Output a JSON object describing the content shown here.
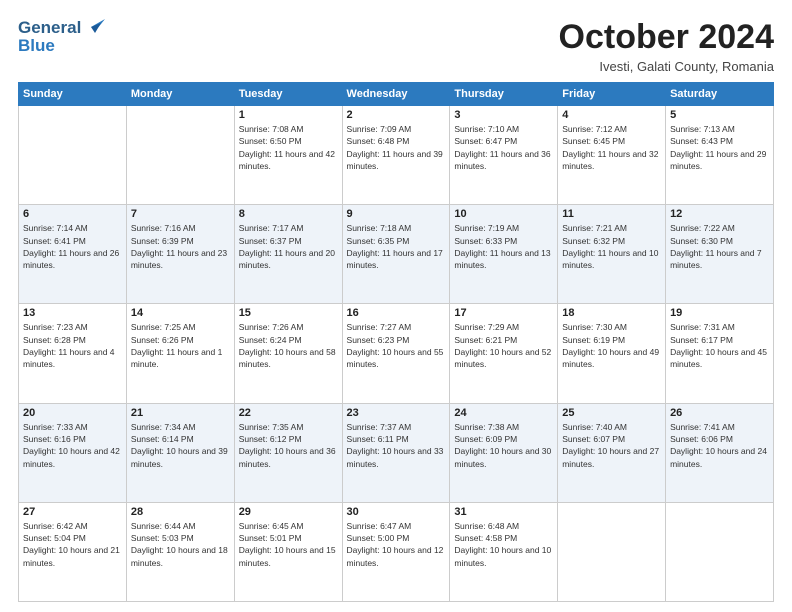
{
  "header": {
    "logo_general": "General",
    "logo_blue": "Blue",
    "title": "October 2024",
    "location": "Ivesti, Galati County, Romania"
  },
  "days_of_week": [
    "Sunday",
    "Monday",
    "Tuesday",
    "Wednesday",
    "Thursday",
    "Friday",
    "Saturday"
  ],
  "weeks": [
    [
      {
        "day": "",
        "sunrise": "",
        "sunset": "",
        "daylight": ""
      },
      {
        "day": "",
        "sunrise": "",
        "sunset": "",
        "daylight": ""
      },
      {
        "day": "1",
        "sunrise": "Sunrise: 7:08 AM",
        "sunset": "Sunset: 6:50 PM",
        "daylight": "Daylight: 11 hours and 42 minutes."
      },
      {
        "day": "2",
        "sunrise": "Sunrise: 7:09 AM",
        "sunset": "Sunset: 6:48 PM",
        "daylight": "Daylight: 11 hours and 39 minutes."
      },
      {
        "day": "3",
        "sunrise": "Sunrise: 7:10 AM",
        "sunset": "Sunset: 6:47 PM",
        "daylight": "Daylight: 11 hours and 36 minutes."
      },
      {
        "day": "4",
        "sunrise": "Sunrise: 7:12 AM",
        "sunset": "Sunset: 6:45 PM",
        "daylight": "Daylight: 11 hours and 32 minutes."
      },
      {
        "day": "5",
        "sunrise": "Sunrise: 7:13 AM",
        "sunset": "Sunset: 6:43 PM",
        "daylight": "Daylight: 11 hours and 29 minutes."
      }
    ],
    [
      {
        "day": "6",
        "sunrise": "Sunrise: 7:14 AM",
        "sunset": "Sunset: 6:41 PM",
        "daylight": "Daylight: 11 hours and 26 minutes."
      },
      {
        "day": "7",
        "sunrise": "Sunrise: 7:16 AM",
        "sunset": "Sunset: 6:39 PM",
        "daylight": "Daylight: 11 hours and 23 minutes."
      },
      {
        "day": "8",
        "sunrise": "Sunrise: 7:17 AM",
        "sunset": "Sunset: 6:37 PM",
        "daylight": "Daylight: 11 hours and 20 minutes."
      },
      {
        "day": "9",
        "sunrise": "Sunrise: 7:18 AM",
        "sunset": "Sunset: 6:35 PM",
        "daylight": "Daylight: 11 hours and 17 minutes."
      },
      {
        "day": "10",
        "sunrise": "Sunrise: 7:19 AM",
        "sunset": "Sunset: 6:33 PM",
        "daylight": "Daylight: 11 hours and 13 minutes."
      },
      {
        "day": "11",
        "sunrise": "Sunrise: 7:21 AM",
        "sunset": "Sunset: 6:32 PM",
        "daylight": "Daylight: 11 hours and 10 minutes."
      },
      {
        "day": "12",
        "sunrise": "Sunrise: 7:22 AM",
        "sunset": "Sunset: 6:30 PM",
        "daylight": "Daylight: 11 hours and 7 minutes."
      }
    ],
    [
      {
        "day": "13",
        "sunrise": "Sunrise: 7:23 AM",
        "sunset": "Sunset: 6:28 PM",
        "daylight": "Daylight: 11 hours and 4 minutes."
      },
      {
        "day": "14",
        "sunrise": "Sunrise: 7:25 AM",
        "sunset": "Sunset: 6:26 PM",
        "daylight": "Daylight: 11 hours and 1 minute."
      },
      {
        "day": "15",
        "sunrise": "Sunrise: 7:26 AM",
        "sunset": "Sunset: 6:24 PM",
        "daylight": "Daylight: 10 hours and 58 minutes."
      },
      {
        "day": "16",
        "sunrise": "Sunrise: 7:27 AM",
        "sunset": "Sunset: 6:23 PM",
        "daylight": "Daylight: 10 hours and 55 minutes."
      },
      {
        "day": "17",
        "sunrise": "Sunrise: 7:29 AM",
        "sunset": "Sunset: 6:21 PM",
        "daylight": "Daylight: 10 hours and 52 minutes."
      },
      {
        "day": "18",
        "sunrise": "Sunrise: 7:30 AM",
        "sunset": "Sunset: 6:19 PM",
        "daylight": "Daylight: 10 hours and 49 minutes."
      },
      {
        "day": "19",
        "sunrise": "Sunrise: 7:31 AM",
        "sunset": "Sunset: 6:17 PM",
        "daylight": "Daylight: 10 hours and 45 minutes."
      }
    ],
    [
      {
        "day": "20",
        "sunrise": "Sunrise: 7:33 AM",
        "sunset": "Sunset: 6:16 PM",
        "daylight": "Daylight: 10 hours and 42 minutes."
      },
      {
        "day": "21",
        "sunrise": "Sunrise: 7:34 AM",
        "sunset": "Sunset: 6:14 PM",
        "daylight": "Daylight: 10 hours and 39 minutes."
      },
      {
        "day": "22",
        "sunrise": "Sunrise: 7:35 AM",
        "sunset": "Sunset: 6:12 PM",
        "daylight": "Daylight: 10 hours and 36 minutes."
      },
      {
        "day": "23",
        "sunrise": "Sunrise: 7:37 AM",
        "sunset": "Sunset: 6:11 PM",
        "daylight": "Daylight: 10 hours and 33 minutes."
      },
      {
        "day": "24",
        "sunrise": "Sunrise: 7:38 AM",
        "sunset": "Sunset: 6:09 PM",
        "daylight": "Daylight: 10 hours and 30 minutes."
      },
      {
        "day": "25",
        "sunrise": "Sunrise: 7:40 AM",
        "sunset": "Sunset: 6:07 PM",
        "daylight": "Daylight: 10 hours and 27 minutes."
      },
      {
        "day": "26",
        "sunrise": "Sunrise: 7:41 AM",
        "sunset": "Sunset: 6:06 PM",
        "daylight": "Daylight: 10 hours and 24 minutes."
      }
    ],
    [
      {
        "day": "27",
        "sunrise": "Sunrise: 6:42 AM",
        "sunset": "Sunset: 5:04 PM",
        "daylight": "Daylight: 10 hours and 21 minutes."
      },
      {
        "day": "28",
        "sunrise": "Sunrise: 6:44 AM",
        "sunset": "Sunset: 5:03 PM",
        "daylight": "Daylight: 10 hours and 18 minutes."
      },
      {
        "day": "29",
        "sunrise": "Sunrise: 6:45 AM",
        "sunset": "Sunset: 5:01 PM",
        "daylight": "Daylight: 10 hours and 15 minutes."
      },
      {
        "day": "30",
        "sunrise": "Sunrise: 6:47 AM",
        "sunset": "Sunset: 5:00 PM",
        "daylight": "Daylight: 10 hours and 12 minutes."
      },
      {
        "day": "31",
        "sunrise": "Sunrise: 6:48 AM",
        "sunset": "Sunset: 4:58 PM",
        "daylight": "Daylight: 10 hours and 10 minutes."
      },
      {
        "day": "",
        "sunrise": "",
        "sunset": "",
        "daylight": ""
      },
      {
        "day": "",
        "sunrise": "",
        "sunset": "",
        "daylight": ""
      }
    ]
  ]
}
